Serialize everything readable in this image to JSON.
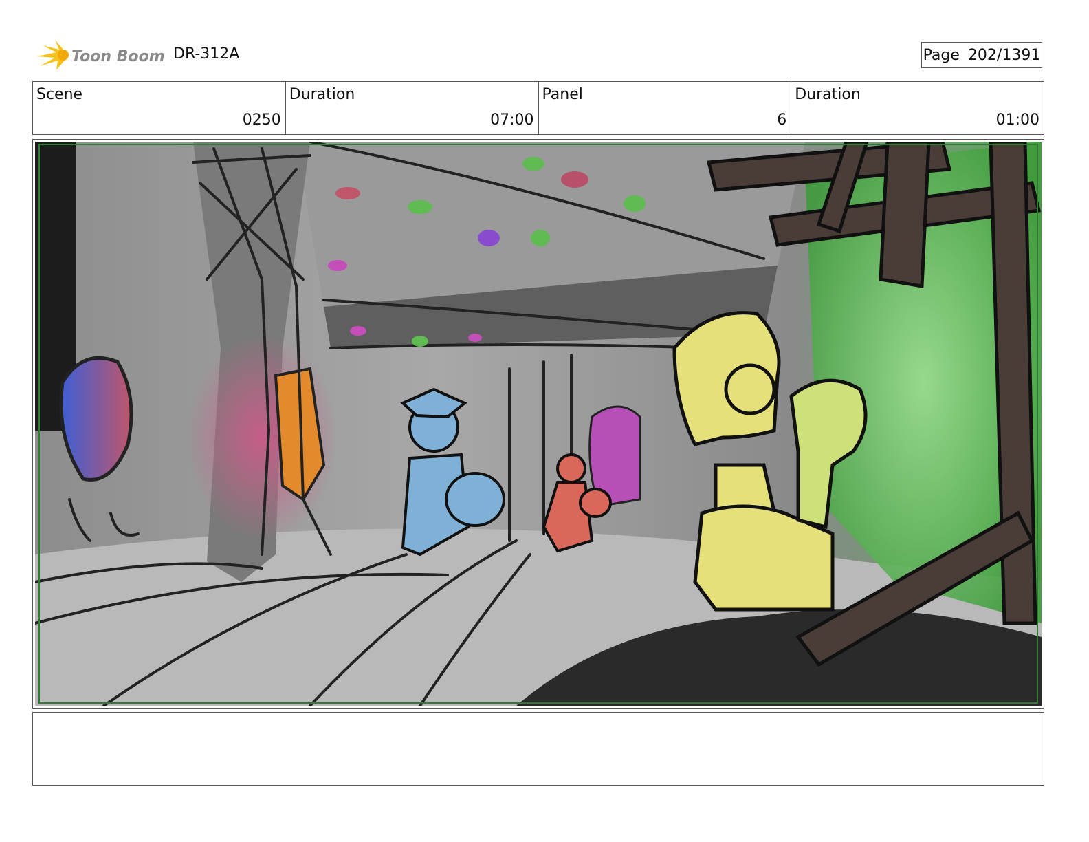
{
  "header": {
    "logo_text": "Toon Boom",
    "project_code": "DR-312A",
    "page_label": "Page",
    "page_number": "202/1391"
  },
  "info": {
    "scene_label": "Scene",
    "scene_value": "0250",
    "scene_duration_label": "Duration",
    "scene_duration_value": "07:00",
    "panel_label": "Panel",
    "panel_value": "6",
    "panel_duration_label": "Duration",
    "panel_duration_value": "01:00"
  },
  "notes": {
    "text": ""
  },
  "colors": {
    "frame_border": "#555555",
    "safe_area": "#2e7d32",
    "logo_flame": "#f7c21a"
  }
}
